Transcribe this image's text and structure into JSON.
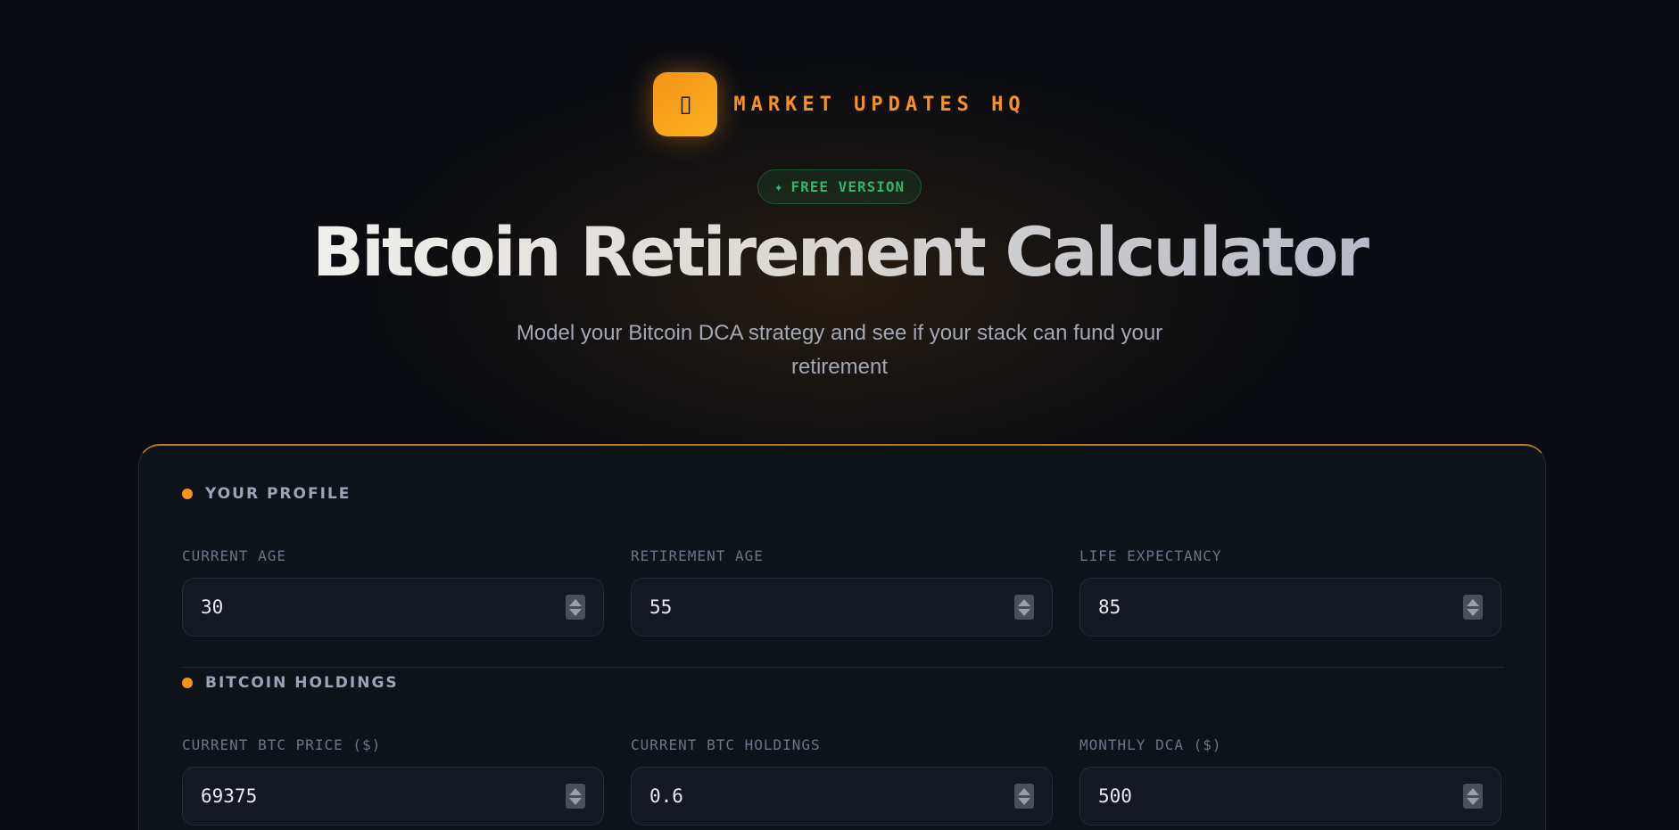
{
  "brand": {
    "logo_glyph": "▯",
    "name": "MARKET UPDATES HQ",
    "accent": "#f7931a"
  },
  "badge": {
    "icon": "sparkle-icon",
    "icon_glyph": "✦",
    "label": "FREE VERSION"
  },
  "hero": {
    "title": "Bitcoin Retirement Calculator",
    "subtitle": "Model your Bitcoin DCA strategy and see if your stack can fund your retirement"
  },
  "sections": {
    "profile": {
      "title": "YOUR PROFILE",
      "fields": [
        {
          "label": "CURRENT AGE",
          "value": "30"
        },
        {
          "label": "RETIREMENT AGE",
          "value": "55"
        },
        {
          "label": "LIFE EXPECTANCY",
          "value": "85"
        }
      ]
    },
    "holdings": {
      "title": "BITCOIN HOLDINGS",
      "fields": [
        {
          "label": "CURRENT BTC PRICE ($)",
          "value": "69375"
        },
        {
          "label": "CURRENT BTC HOLDINGS",
          "value": "0.6"
        },
        {
          "label": "MONTHLY DCA ($)",
          "value": "500"
        }
      ]
    }
  }
}
